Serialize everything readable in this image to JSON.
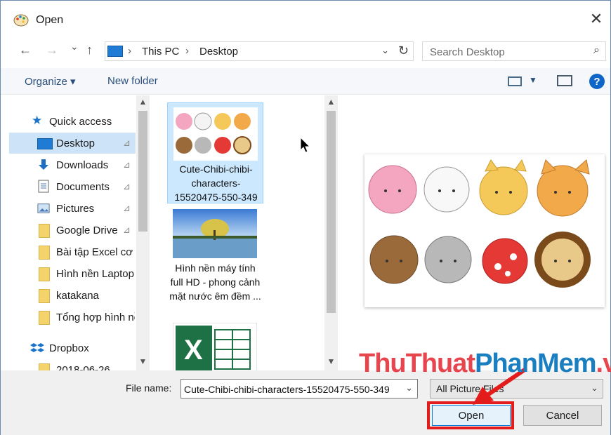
{
  "window": {
    "title": "Open",
    "close_glyph": "✕"
  },
  "address": {
    "back_glyph": "←",
    "forward_glyph": "→",
    "recent_glyph": "⌄",
    "up_glyph": "↑",
    "crumbs": [
      "This PC",
      "Desktop"
    ],
    "dropdown_glyph": "⌄",
    "refresh_glyph": "↻",
    "search_placeholder": "Search Desktop",
    "search_glyph": "⌕"
  },
  "toolbar": {
    "organize_label": "Organize ▾",
    "new_folder_label": "New folder",
    "help_glyph": "?"
  },
  "nav": {
    "quick_access": "Quick access",
    "items": [
      {
        "label": "Desktop",
        "icon": "desktop-icon",
        "pinned": true,
        "selected": true
      },
      {
        "label": "Downloads",
        "icon": "download-icon",
        "pinned": true
      },
      {
        "label": "Documents",
        "icon": "document-icon",
        "pinned": true
      },
      {
        "label": "Pictures",
        "icon": "pictures-icon",
        "pinned": true
      },
      {
        "label": "Google Drive",
        "icon": "folder-icon",
        "pinned": true
      },
      {
        "label": "Bài tập Excel cơ bản",
        "icon": "folder-synced-icon"
      },
      {
        "label": "Hình nền Laptop",
        "icon": "folder-synced-icon"
      },
      {
        "label": "katakana",
        "icon": "folder-synced-icon"
      },
      {
        "label": "Tổng hợp hình nền",
        "icon": "folder-synced-icon"
      }
    ],
    "dropbox": "Dropbox",
    "dropbox_child": "2018-06-26",
    "pin_glyph": "📌",
    "scroll_up": "▲",
    "scroll_down": "▼"
  },
  "files": [
    {
      "label": "Cute-Chibi-chibi-characters-15520475-550-349",
      "selected": true
    },
    {
      "label": "Hình nền máy tính full HD - phong cảnh mặt nước êm đềm ..."
    },
    {
      "label": ""
    }
  ],
  "bottom": {
    "file_name_label": "File name:",
    "file_name_value": "Cute-Chibi-chibi-characters-15520475-550-349",
    "filter_label": "All Picture Files",
    "open_label": "Open",
    "cancel_label": "Cancel"
  },
  "watermark": {
    "part1": "ThuThuat",
    "part2": "PhanMem",
    "part3": ".vn"
  },
  "colors": {
    "accent": "#1066c8",
    "selection": "#cce8ff",
    "highlight": "#e31b1b"
  }
}
